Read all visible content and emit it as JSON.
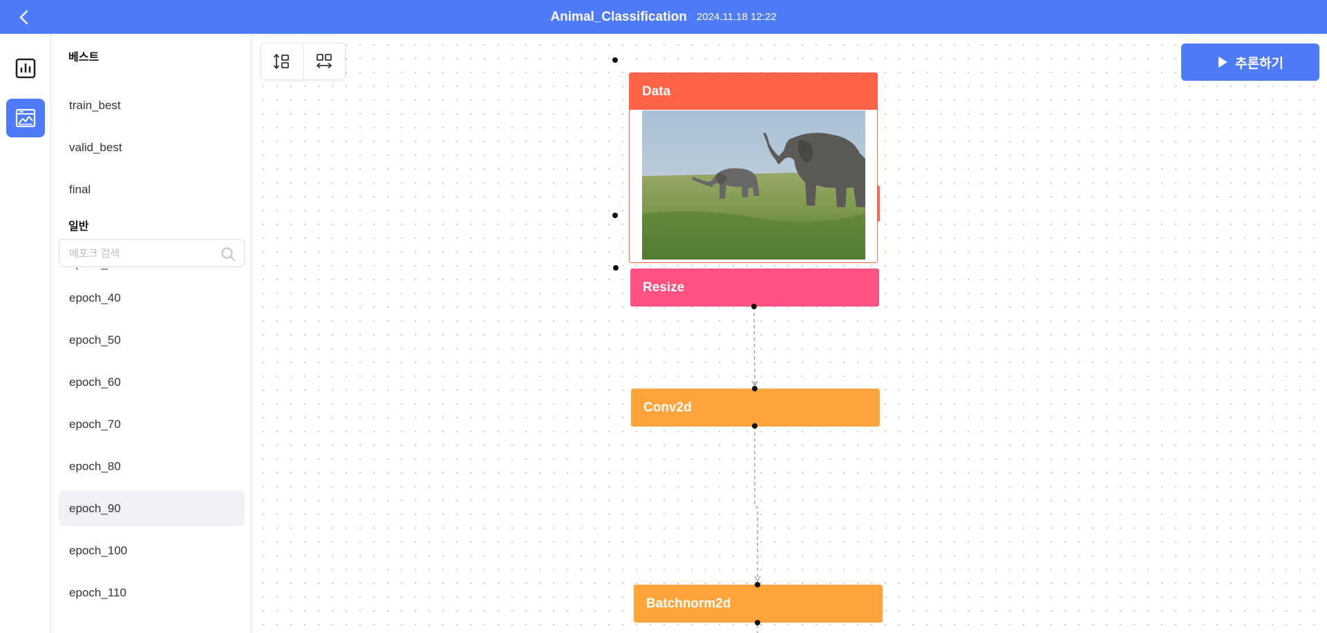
{
  "header": {
    "title": "Animal_Classification",
    "datetime": "2024.11.18 12:22",
    "bg_color": "#4d7bf9"
  },
  "rail": {
    "items": [
      {
        "icon": "bar-chart-icon",
        "active": false
      },
      {
        "icon": "image-gallery-icon",
        "active": true
      }
    ]
  },
  "sidebar": {
    "best_title": "베스트",
    "best_items": [
      "train_best",
      "valid_best",
      "final"
    ],
    "general_title": "일반",
    "search_placeholder": "에포크 검색",
    "epochs": [
      "epoch_30",
      "epoch_40",
      "epoch_50",
      "epoch_60",
      "epoch_70",
      "epoch_80",
      "epoch_90",
      "epoch_100",
      "epoch_110"
    ],
    "selected_epoch": "epoch_90"
  },
  "toolbar": {
    "vertical_layout_icon": "vertical-layout-icon",
    "horizontal_layout_icon": "horizontal-layout-icon"
  },
  "run_button": {
    "label": "추론하기",
    "icon": "play-icon"
  },
  "nodes": [
    {
      "label": "Data",
      "color": "#ff6449",
      "preview": "elephants-photo"
    },
    {
      "label": "Resize",
      "color": "#ff5280"
    },
    {
      "label": "Conv2d",
      "color": "#ffa43a"
    },
    {
      "label": "Batchnorm2d",
      "color": "#ffa43a"
    }
  ]
}
